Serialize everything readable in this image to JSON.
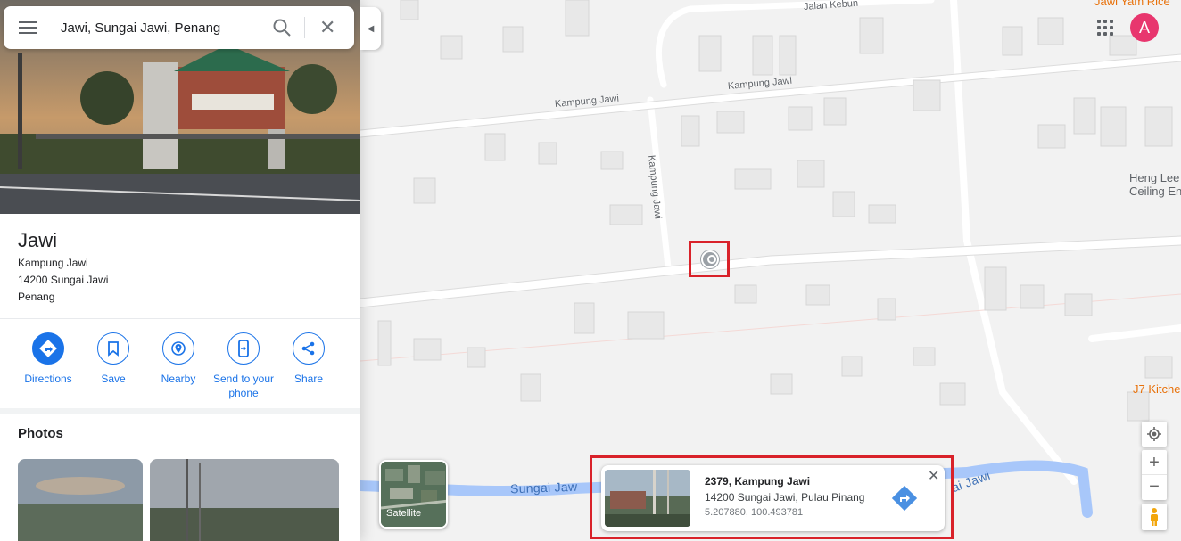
{
  "search": {
    "value": "Jawi, Sungai Jawi, Penang"
  },
  "place": {
    "title": "Jawi",
    "address_lines": [
      "Kampung Jawi",
      "14200 Sungai Jawi",
      "Penang"
    ]
  },
  "actions": [
    {
      "label": "Directions",
      "icon": "directions-icon"
    },
    {
      "label": "Save",
      "icon": "bookmark-icon"
    },
    {
      "label": "Nearby",
      "icon": "nearby-icon"
    },
    {
      "label": "Send to your phone",
      "icon": "phone-icon"
    },
    {
      "label": "Share",
      "icon": "share-icon"
    }
  ],
  "photos_title": "Photos",
  "map": {
    "street_labels": [
      "Jalan Kebun",
      "Kampung Jawi",
      "Kampung Jawi",
      "Kampung Jawi"
    ],
    "poi": [
      "Jawi Yam Rice",
      "Heng Lee Ceiling En",
      "J7 Kitche"
    ],
    "river_labels": [
      "Sungai Jaw",
      "ai Jawi"
    ],
    "satellite_label": "Satellite",
    "avatar_letter": "A",
    "zoom_in": "+",
    "zoom_out": "−"
  },
  "info_card": {
    "title": "2379, Kampung Jawi",
    "address": "14200 Sungai Jawi, Pulau Pinang",
    "coords": "5.207880, 100.493781"
  },
  "colors": {
    "accent": "#1a73e8",
    "highlight": "#d9222a",
    "avatar": "#e8366e",
    "river": "#a8c7fa"
  }
}
